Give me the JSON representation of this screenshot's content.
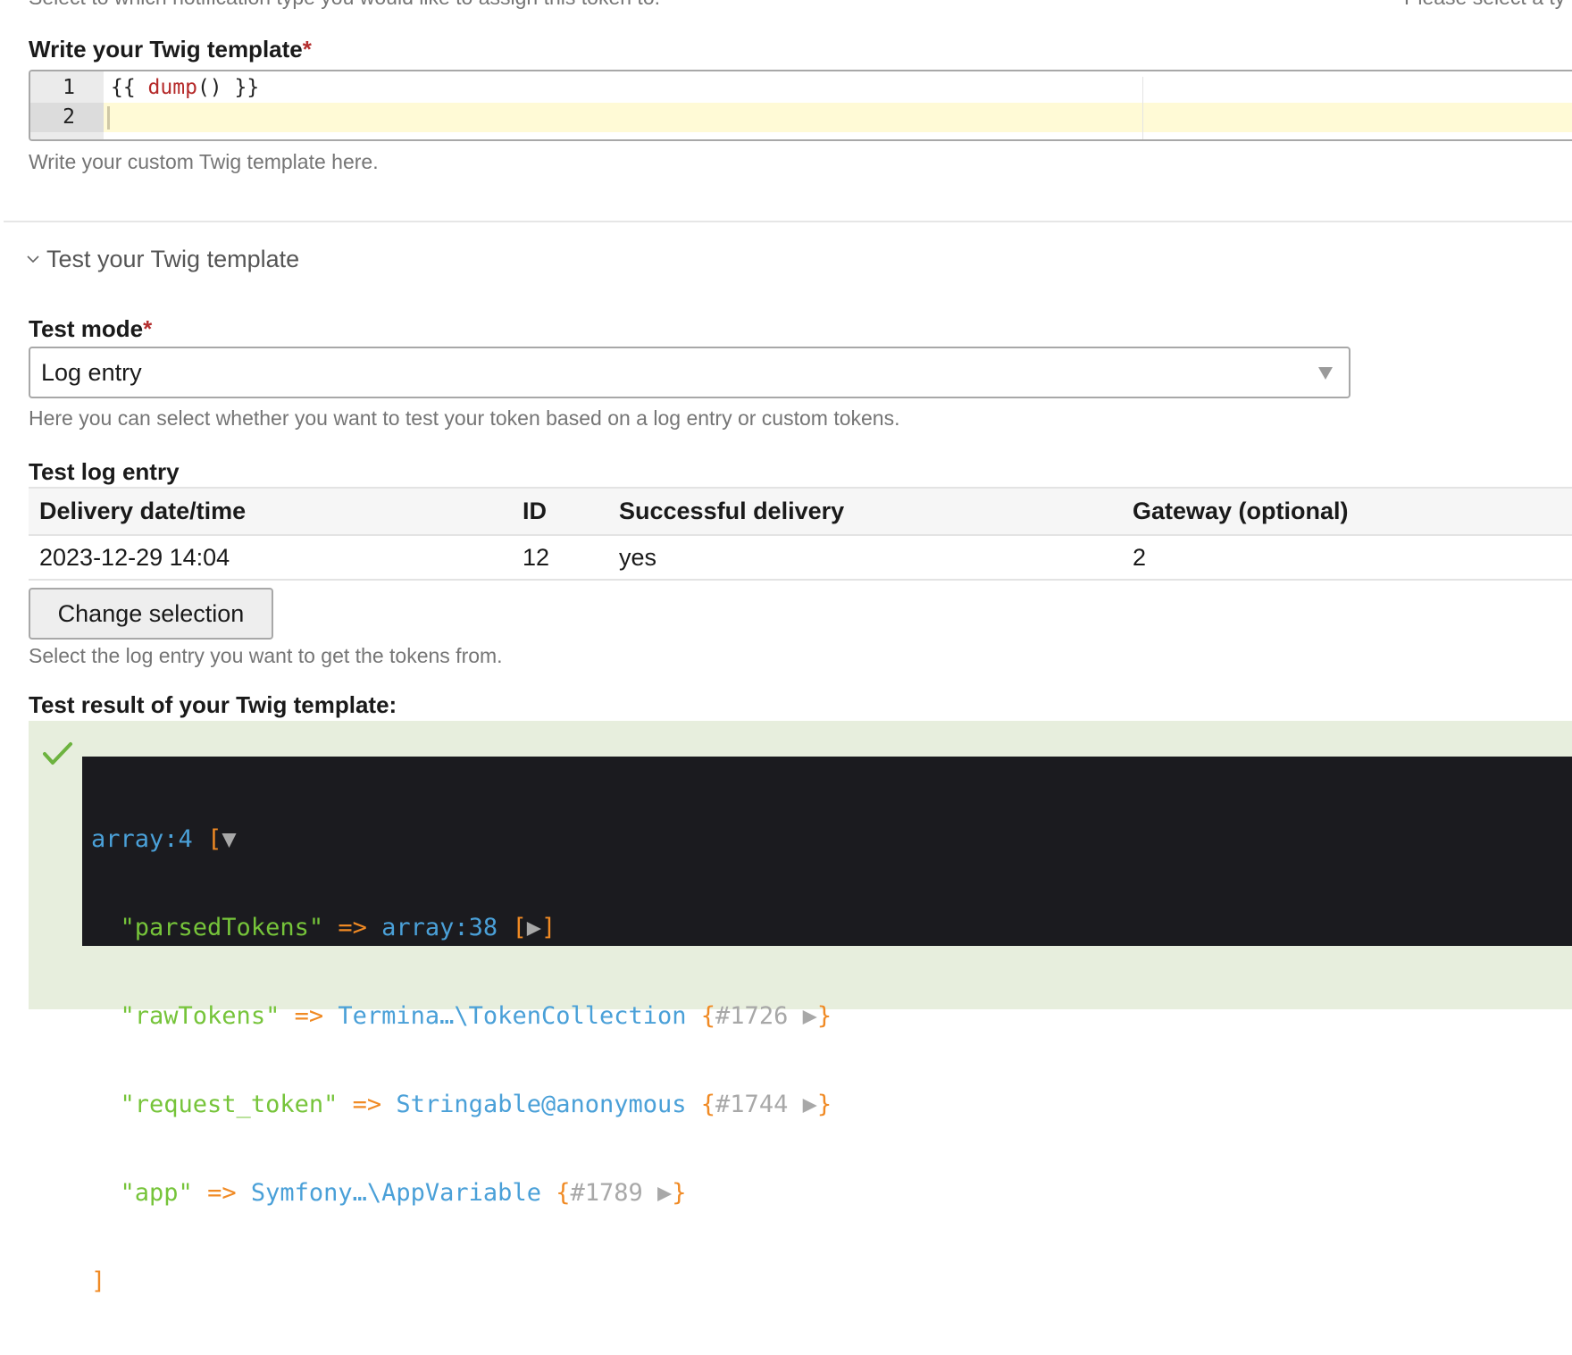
{
  "top": {
    "notification_type_desc": "Select to which notification type you would like to assign this token to.",
    "right_desc_fragment": "Please select a ty"
  },
  "twig": {
    "label": "Write your Twig template",
    "required_mark": "*",
    "editor": {
      "lines": [
        {
          "number": "1",
          "open": "{{ ",
          "function": "dump",
          "close": "() }}"
        },
        {
          "number": "2",
          "text": ""
        }
      ],
      "active_line": 2
    },
    "description": "Write your custom Twig template here."
  },
  "test": {
    "summary_label": "Test your Twig template",
    "expanded": true,
    "chevron_icon": "chevron-down-icon",
    "mode": {
      "label": "Test mode",
      "required_mark": "*",
      "selected": "Log entry",
      "description": "Here you can select whether you want to test your token based on a log entry or custom tokens."
    },
    "log_entry": {
      "label": "Test log entry",
      "columns": [
        "Delivery date/time",
        "ID",
        "Successful delivery",
        "Gateway (optional)"
      ],
      "rows": [
        [
          "2023-12-29 14:04",
          "12",
          "yes",
          "2"
        ]
      ],
      "change_button": "Change selection",
      "description": "Select the log entry you want to get the tokens from."
    },
    "result": {
      "label": "Test result of your Twig template:",
      "status_icon": "check-icon",
      "status_color": "#6db33f",
      "dump": {
        "header_type": "array:4",
        "header_open": "[",
        "header_toggle": "▼",
        "entries": [
          {
            "key": "\"parsedTokens\"",
            "arrow": "=>",
            "type": "array:38",
            "open": "[",
            "toggle": "▶",
            "close": "]",
            "ref": ""
          },
          {
            "key": "\"rawTokens\"",
            "arrow": "=>",
            "type": "Termina…\\TokenCollection",
            "open": "{",
            "ref": "#1726",
            "toggle": "▶",
            "close": "}"
          },
          {
            "key": "\"request_token\"",
            "arrow": "=>",
            "type": "Stringable@anonymous",
            "open": "{",
            "ref": "#1744",
            "toggle": "▶",
            "close": "}"
          },
          {
            "key": "\"app\"",
            "arrow": "=>",
            "type": "Symfony…\\AppVariable",
            "open": "{",
            "ref": "#1789",
            "toggle": "▶",
            "close": "}"
          }
        ],
        "footer_close": "]"
      }
    }
  },
  "colors": {
    "required": "#b53030",
    "dump_background": "#1b1b1f",
    "dump_type": "#4aa0d8",
    "dump_key": "#76c43a",
    "dump_punct": "#f08a24",
    "result_background": "#e7eedd",
    "active_line": "#fffad6"
  }
}
